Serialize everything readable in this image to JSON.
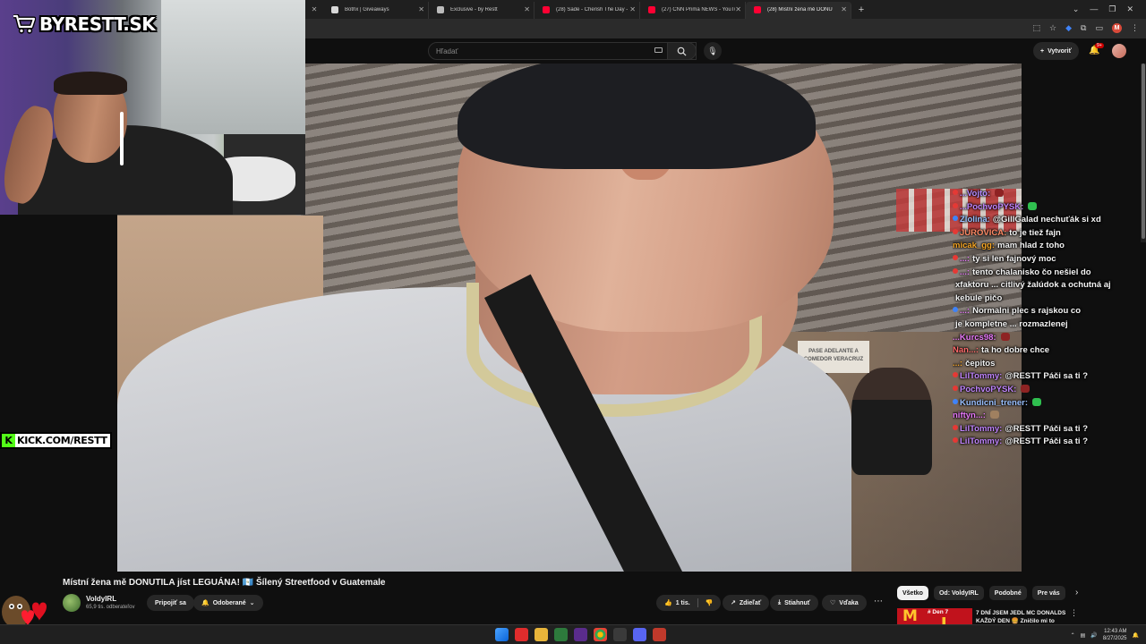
{
  "browser": {
    "tabs": [
      {
        "label": "Botřix | Giveaways",
        "fav_color": "#d8d8d8",
        "active": false
      },
      {
        "label": "Exclusive - by Restt",
        "fav_color": "#bbbbbb",
        "active": false
      },
      {
        "label": "(28) Sade - Cherish The Day - ",
        "fav_color": "#ff0033",
        "active": false
      },
      {
        "label": "(27) CNN Prima NEWS - YouTub",
        "fav_color": "#ff0033",
        "active": false
      },
      {
        "label": "(28) Místní žena mě DONU",
        "fav_color": "#ff0033",
        "active": true
      }
    ],
    "profile_initial": "M"
  },
  "youtube": {
    "search_placeholder": "Hľadať",
    "create_label": "Vytvoriť",
    "notifications_badge": "9+"
  },
  "overlay": {
    "logo_text": "BYRESTT.SK",
    "kick_text": "KICK.COM/RESTT",
    "video_sign": "PASE ADELANTE A COMEDOR VERACRUZ"
  },
  "chat": [
    {
      "user": "...Vojto:",
      "user_color": "#b38cff",
      "msg": "",
      "badge": "#e53935",
      "emote": "#8e2323"
    },
    {
      "user": "...PochvoPYSK:",
      "user_color": "#c084fc",
      "msg": "",
      "badge": "#e53935",
      "emote": "#2fbf4f"
    },
    {
      "user": "Zlolina:",
      "user_color": "#9ac0ff",
      "msg": "@GillGalad nechuťák si xd",
      "badge": "#3f83f8",
      "emote": ""
    },
    {
      "user": "JUROVICA:",
      "user_color": "#ff8a65",
      "msg": "to je tiež fajn",
      "badge": "#e53935",
      "emote": ""
    },
    {
      "user": "micak_gg:",
      "user_color": "#f5a524",
      "msg": "mam hlad z toho",
      "badge": "",
      "emote": ""
    },
    {
      "user": "...:",
      "user_color": "#e879f9",
      "msg": "ty si len fajnový moc",
      "badge": "#e53935",
      "emote": ""
    },
    {
      "user": "...:",
      "user_color": "#e879f9",
      "msg": "tento chalanisko čo nešiel do",
      "badge": "#e53935",
      "emote": ""
    },
    {
      "user": "",
      "user_color": "#ffffff",
      "msg": "xfaktoru ... citlivý žalúdok a ochutná aj",
      "badge": "",
      "emote": ""
    },
    {
      "user": "",
      "user_color": "#ffffff",
      "msg": "kebule pičo",
      "badge": "",
      "emote": ""
    },
    {
      "user": "...:",
      "user_color": "#e879f9",
      "msg": "Normalni plec s rajskou co",
      "badge": "#3f83f8",
      "emote": ""
    },
    {
      "user": "",
      "user_color": "#ffffff",
      "msg": "je kompletne ... rozmazlenej",
      "badge": "",
      "emote": ""
    },
    {
      "user": "...Kurcs98:",
      "user_color": "#e879f9",
      "msg": "",
      "badge": "",
      "emote": "#8e2323"
    },
    {
      "user": "Nan...:",
      "user_color": "#ff6b6b",
      "msg": "ta ho dobre chce",
      "badge": "",
      "emote": ""
    },
    {
      "user": "...:",
      "user_color": "#f5a524",
      "msg": "čepitos",
      "badge": "",
      "emote": ""
    },
    {
      "user": "LilTommy:",
      "user_color": "#c084fc",
      "msg": "@RESTT Páči sa ti ?",
      "badge": "#e53935",
      "emote": ""
    },
    {
      "user": "PochvoPYSK:",
      "user_color": "#c084fc",
      "msg": "",
      "badge": "#e53935",
      "emote": "#8e2323"
    },
    {
      "user": "Kundicni_trener:",
      "user_color": "#9ac0ff",
      "msg": "",
      "badge": "#3f83f8",
      "emote": "#2fbf4f"
    },
    {
      "user": "niftyn...:",
      "user_color": "#e879f9",
      "msg": "",
      "badge": "",
      "emote": "#a08060"
    },
    {
      "user": "LilTommy:",
      "user_color": "#c084fc",
      "msg": "@RESTT Páči sa ti ?",
      "badge": "#e53935",
      "emote": ""
    },
    {
      "user": "LilTommy:",
      "user_color": "#c084fc",
      "msg": "@RESTT Páči sa ti ?",
      "badge": "#e53935",
      "emote": ""
    }
  ],
  "video": {
    "title": "Místní žena mě DONUTILA jíst LEGUÁNA! 🇬🇹 Šílený Streetfood v Guatemale",
    "channel": "VoldyIRL",
    "subscribers": "65,9 tis. odberateľov",
    "join_label": "Pripojiť sa",
    "subscribed_label": "Odoberané",
    "likes": "1 tis.",
    "share_label": "Zdieľať",
    "download_label": "Stiahnuť",
    "thanks_label": "Vďaka"
  },
  "sidebar": {
    "chips": [
      {
        "label": "Všetko",
        "active": true
      },
      {
        "label": "Od: VoldyIRL",
        "active": false
      },
      {
        "label": "Podobné",
        "active": false
      },
      {
        "label": "Pre vás",
        "active": false
      }
    ],
    "rec_badge": "# Den 7",
    "rec_title": "7 DNÍ JSEM JEDL MC DONALDS KAŽDÝ DEN 🍔 Zničilo mi to"
  },
  "taskbar": {
    "time": "12:43 AM",
    "date": "8/27/2025"
  }
}
